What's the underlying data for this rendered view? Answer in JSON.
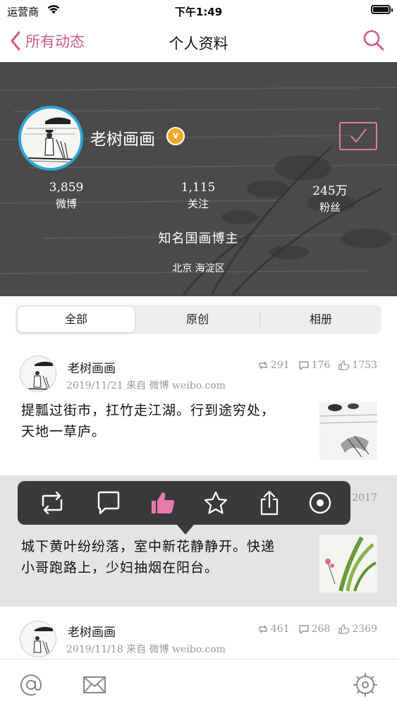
{
  "status_bar": {
    "carrier": "运营商",
    "time": "下午1:49"
  },
  "nav": {
    "back_label": "所有动态",
    "title": "个人资料"
  },
  "profile": {
    "name": "老树画画",
    "verified_mark": "v",
    "stats": [
      {
        "value": "3,859",
        "label": "微博"
      },
      {
        "value": "1,115",
        "label": "关注"
      },
      {
        "value": "245万",
        "label": "粉丝"
      }
    ],
    "bio": "知名国画博主",
    "location": "北京 海淀区"
  },
  "tabs": [
    {
      "label": "全部",
      "active": true
    },
    {
      "label": "原创",
      "active": false
    },
    {
      "label": "相册",
      "active": false
    }
  ],
  "posts": [
    {
      "author": "老树画画",
      "meta": "2019/11/21 来自 微博 weibo.com",
      "reposts": "291",
      "comments": "176",
      "likes": "1753",
      "text_line1": "提瓢过街市，扛竹走江湖。行到途穷处，",
      "text_line2": "天地一草庐。"
    },
    {
      "likes": "2017",
      "text_line1": "城下黄叶纷纷落，室中新花静静开。快递",
      "text_line2": "小哥跑路上，少妇抽烟在阳台。"
    },
    {
      "author": "老树画画",
      "meta": "2019/11/18 来自 微博 weibo.com",
      "reposts": "461",
      "comments": "268",
      "likes": "2369"
    }
  ],
  "popup_actions": [
    "repost-icon",
    "comment-icon",
    "like-icon",
    "star-icon",
    "share-icon",
    "record-icon"
  ],
  "tabbar": [
    "at-icon",
    "mail-icon",
    "settings-icon"
  ],
  "colors": {
    "accent": "#d45a8a",
    "avatar_ring": "#2fa6d6",
    "badge": "#f5a623",
    "popup_bg": "#3a3a3c",
    "like_active": "#e77aa8"
  }
}
